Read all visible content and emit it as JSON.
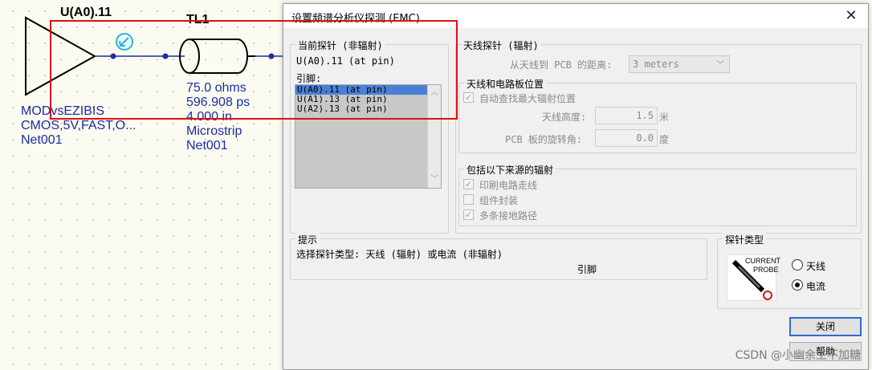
{
  "schematic": {
    "driver_label": "U(A0).11",
    "tline_label": "TL1",
    "driver_lines": [
      "MODvsEZIBIS",
      "CMOS,5V,FAST,O...",
      "Net001"
    ],
    "tline_lines": [
      "75.0 ohms",
      "596.908 ps",
      "4.000 in",
      "Microstrip",
      "Net001"
    ]
  },
  "dialog": {
    "title": "设置频谱分析仪探测 (EMC)",
    "current_probe": {
      "group_label": "当前探针 (非辐射)",
      "value": "U(A0).11 (at pin)",
      "pins_label": "引脚:",
      "pins": [
        "U(A0).11 (at pin)",
        "U(A1).13 (at pin)",
        "U(A2).13 (at pin)"
      ],
      "selected_index": 0
    },
    "antenna_probe": {
      "group_label": "天线探针 (辐射)",
      "distance_label": "从天线到 PCB 的距离:",
      "distance_value": "3 meters",
      "position_group_label": "天线和电路板位置",
      "auto_find_label": "自动查找最大辐射位置",
      "auto_find_checked": true,
      "height_label": "天线高度:",
      "height_value": "1.5",
      "height_unit": "米",
      "rotation_label": "PCB 板的旋转角:",
      "rotation_value": "0.0",
      "rotation_unit": "度",
      "sources_group_label": "包括以下来源的辐射",
      "sources": [
        {
          "label": "印刷电路走线",
          "checked": true
        },
        {
          "label": "组件封装",
          "checked": false
        },
        {
          "label": "多条接地路径",
          "checked": true
        }
      ]
    },
    "hint": {
      "group_label": "提示",
      "text": "选择探针类型: 天线 (辐射) 或电流 (非辐射)",
      "sub_text": "引脚"
    },
    "probe_type": {
      "group_label": "探针类型",
      "image_text_1": "CURRENT",
      "image_text_2": "PROBE",
      "options": [
        {
          "label": "天线",
          "selected": false
        },
        {
          "label": "电流",
          "selected": true
        }
      ]
    },
    "buttons": {
      "close": "关闭",
      "help": "帮助"
    }
  },
  "watermark": "CSDN @小幽余生不加糖",
  "colors": {
    "highlight": "#e01010",
    "selection": "#4a7fd6",
    "net": "#1c2da0"
  }
}
